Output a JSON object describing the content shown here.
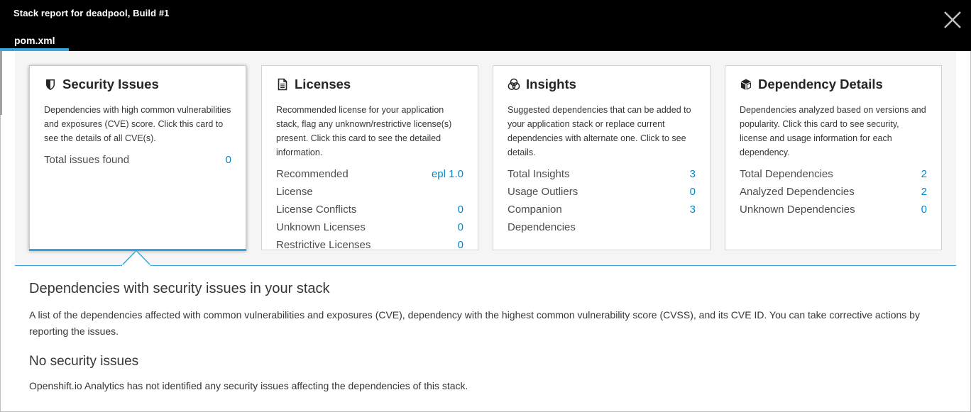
{
  "header": {
    "title": "Stack report for deadpool, Build #1",
    "close_icon": "close-icon",
    "tab_label": "pom.xml"
  },
  "colors": {
    "accent": "#39a5dc",
    "value_link": "#0088ce",
    "header_bg": "#000000",
    "cards_bg": "#f5f5f5"
  },
  "cards": [
    {
      "icon": "shield-icon",
      "title": "Security Issues",
      "description": "Dependencies with high common vulnerabilities and exposures (CVE) score. Click this card to see the details of all CVE(s).",
      "metrics": [
        {
          "label": "Total issues found",
          "value": "0"
        }
      ]
    },
    {
      "icon": "document-icon",
      "title": "Licenses",
      "description": "Recommended license for your application stack, flag any unknown/restrictive license(s) present. Click this card to see the detailed information.",
      "metrics": [
        {
          "label": "Recommended License",
          "value": "epl 1.0"
        },
        {
          "label": "License Conflicts",
          "value": "0"
        },
        {
          "label": "Unknown Licenses",
          "value": "0"
        },
        {
          "label": "Restrictive Licenses",
          "value": "0"
        }
      ]
    },
    {
      "icon": "insights-icon",
      "title": "Insights",
      "description": "Suggested dependencies that can be added to your application stack or replace current dependencies with alternate one. Click to see details.",
      "metrics": [
        {
          "label": "Total Insights",
          "value": "3"
        },
        {
          "label": "Usage Outliers",
          "value": "0"
        },
        {
          "label": "Companion Dependencies",
          "value": "3"
        }
      ]
    },
    {
      "icon": "cube-icon",
      "title": "Dependency Details",
      "description": "Dependencies analyzed based on versions and popularity. Click this card to see security, license and usage information for each dependency.",
      "metrics": [
        {
          "label": "Total Dependencies",
          "value": "2"
        },
        {
          "label": "Analyzed Dependencies",
          "value": "2"
        },
        {
          "label": "Unknown Dependencies",
          "value": "0"
        }
      ]
    }
  ],
  "details": {
    "heading": "Dependencies with security issues in your stack",
    "description": "A list of the dependencies affected with common vulnerabilities and exposures (CVE), dependency with the highest common vulnerability score (CVSS), and its CVE ID. You can take corrective actions by reporting the issues.",
    "status_heading": "No security issues",
    "status_text": "Openshift.io Analytics has not identified any security issues affecting the dependencies of this stack."
  }
}
